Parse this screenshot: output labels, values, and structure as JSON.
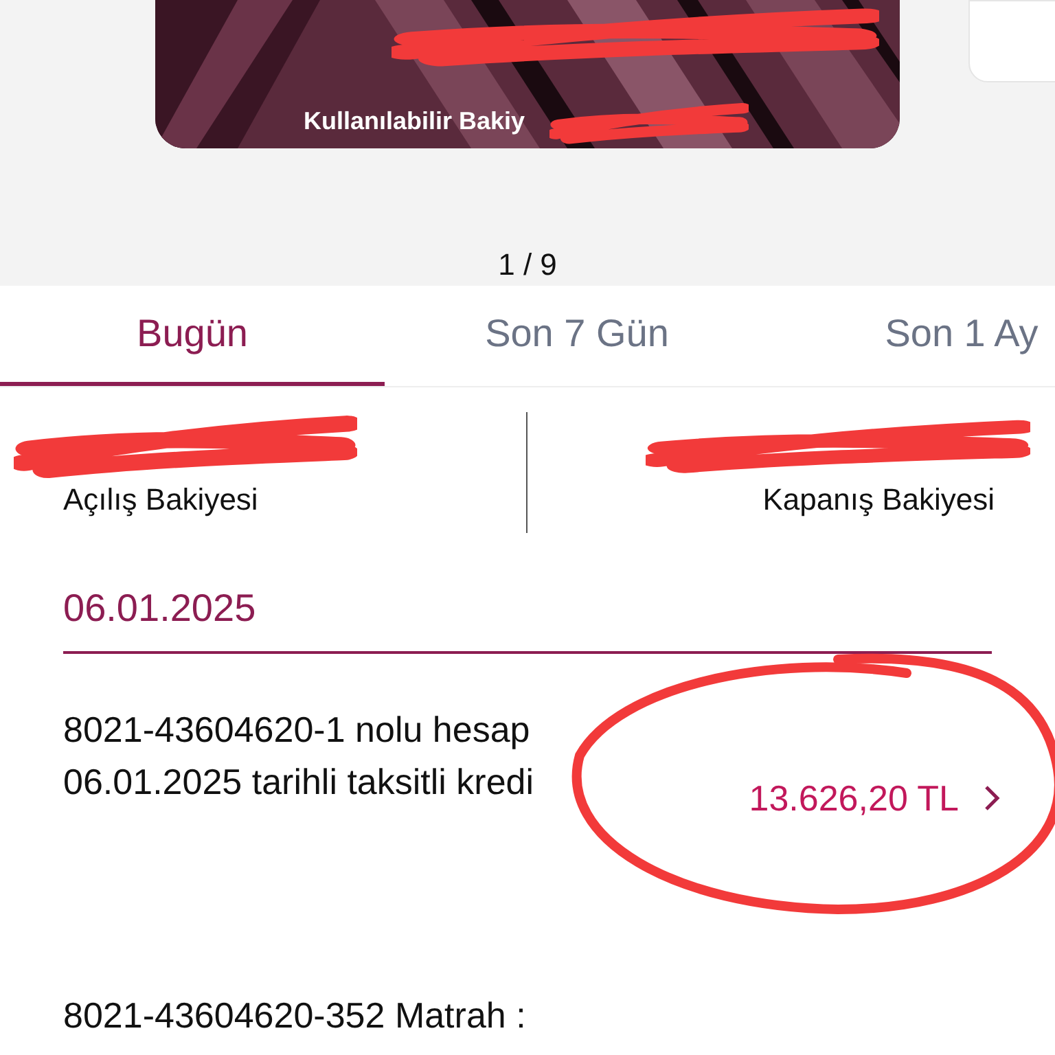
{
  "card": {
    "kind": "picture",
    "caption": "Kullanılabilir Bakiy"
  },
  "pager": "1 / 9",
  "tabs": [
    {
      "label": "Bugün",
      "selected": true
    },
    {
      "label": "Son 7 Gün",
      "selected": false
    },
    {
      "label": "Son 1 Ay",
      "selected": false
    }
  ],
  "balances": [
    {
      "label": "Açılış Bakiyesi"
    },
    {
      "label": "Kapanış Bakiyesi"
    }
  ],
  "date_header": "06.01.2025",
  "transactions": [
    {
      "description": "8021-43604620-1 nolu hesap 06.01.2025 tarihli taksitli kredi",
      "amount": "13.626,20 TL",
      "circled": true
    },
    {
      "description": "8021-43604620-352 Matrah :",
      "circled": false
    }
  ]
}
